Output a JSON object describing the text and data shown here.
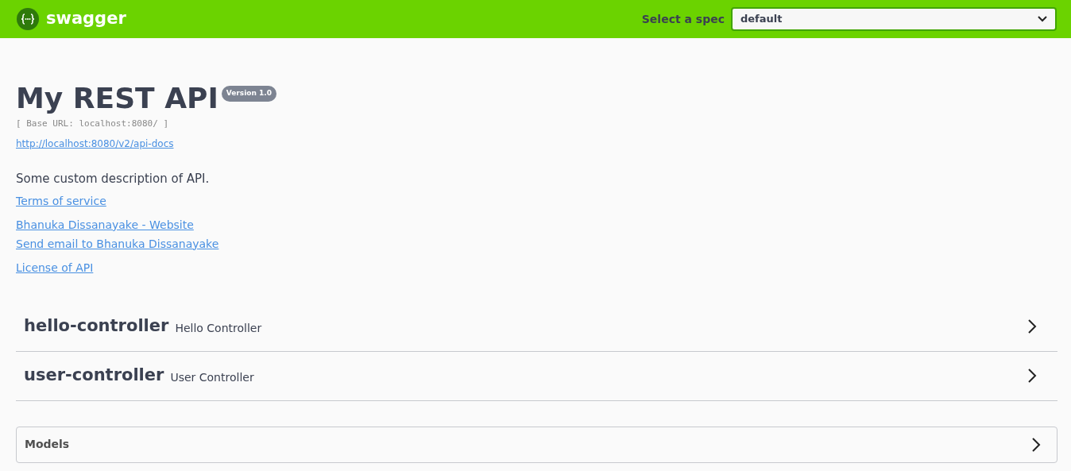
{
  "topbar": {
    "logo_text": "swagger",
    "spec_label": "Select a spec",
    "spec_value": "default"
  },
  "info": {
    "title": "My REST API",
    "version": "Version 1.0",
    "base_url": "[ Base URL: localhost:8080/ ]",
    "docs_link": "http://localhost:8080/v2/api-docs",
    "description": "Some custom description of API.",
    "link_groups": [
      [
        {
          "text": "Terms of service"
        }
      ],
      [
        {
          "text": "Bhanuka Dissanayake - Website"
        },
        {
          "text": "Send email to Bhanuka Dissanayake"
        }
      ],
      [
        {
          "text": "License of API"
        }
      ]
    ]
  },
  "tags": [
    {
      "name": "hello-controller",
      "description": "Hello Controller",
      "expanded": false
    },
    {
      "name": "user-controller",
      "description": "User Controller",
      "expanded": false
    }
  ],
  "models": {
    "title": "Models",
    "expanded": false
  }
}
